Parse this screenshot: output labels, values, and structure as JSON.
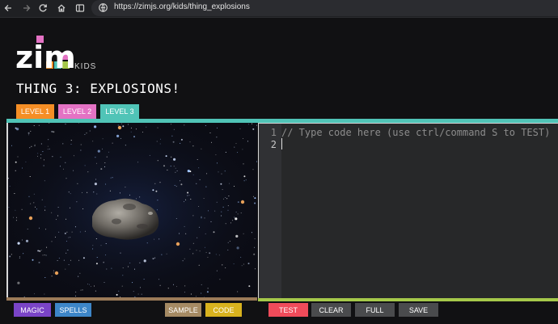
{
  "browser": {
    "url": "https://zimjs.org/kids/thing_explosions",
    "icons": [
      "back-arrow-icon",
      "forward-arrow-icon",
      "reload-icon",
      "home-icon",
      "sidebar-icon",
      "site-info-icon"
    ]
  },
  "logo": {
    "word": "zim",
    "sub": "KIDS"
  },
  "page": {
    "title": "THING 3: EXPLOSIONS!"
  },
  "tabs": [
    {
      "label": "LEVEL 1",
      "color": "#f58e25"
    },
    {
      "label": "LEVEL 2",
      "color": "#e472c4"
    },
    {
      "label": "LEVEL 3",
      "color": "#50c4b7"
    }
  ],
  "editor": {
    "lines": [
      {
        "num": "1",
        "text": "// Type code here (use ctrl/command S to TEST)"
      },
      {
        "num": "2",
        "text": ""
      }
    ]
  },
  "buttons": {
    "magic": "MAGIC",
    "spells": "SPELLS",
    "sample": "SAMPLE",
    "code": "CODE",
    "test": "TEST",
    "clear": "CLEAR",
    "full": "FULL",
    "save": "SAVE"
  }
}
